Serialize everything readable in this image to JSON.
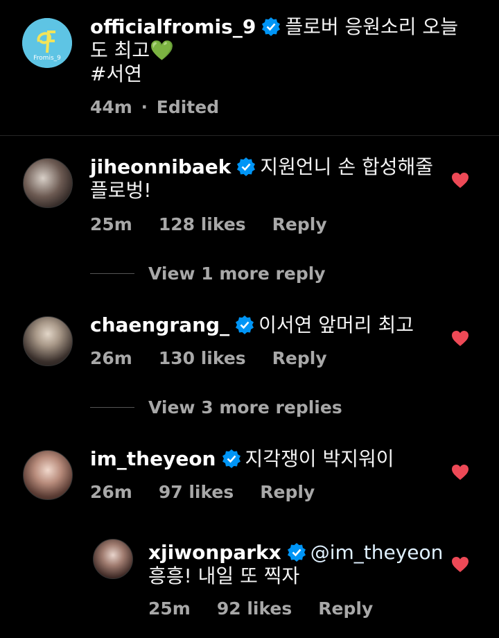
{
  "caption": {
    "username": "officialfromis_9",
    "text_line1": "플로버 응원소리 오늘",
    "text_line2": "도 최고💚",
    "text_line3": "#서연",
    "time": "44m",
    "edited": "Edited",
    "logo_text": "Fromis_9"
  },
  "comments": [
    {
      "username": "jiheonnibaek",
      "text_line1": "지원언니 손 합성해줄",
      "text_line2": "플로벙!",
      "time": "25m",
      "likes": "128 likes",
      "reply": "Reply",
      "view_more": "View 1 more reply"
    },
    {
      "username": "chaengrang_",
      "text_line1": "이서연 앞머리 최고",
      "time": "26m",
      "likes": "130 likes",
      "reply": "Reply",
      "view_more": "View 3 more replies"
    },
    {
      "username": "im_theyeon",
      "text_line1": "지각쟁이 박지워이",
      "time": "26m",
      "likes": "97 likes",
      "reply": "Reply"
    }
  ],
  "reply": {
    "username": "xjiwonparkx",
    "mention": "@im_theyeon",
    "text_line2": "흥흥! 내일 또 찍자",
    "time": "25m",
    "likes": "92 likes",
    "reply": "Reply"
  },
  "colors": {
    "heart": "#ed4956",
    "verified": "#0095f6",
    "logo_bg": "#5ec4e4"
  }
}
